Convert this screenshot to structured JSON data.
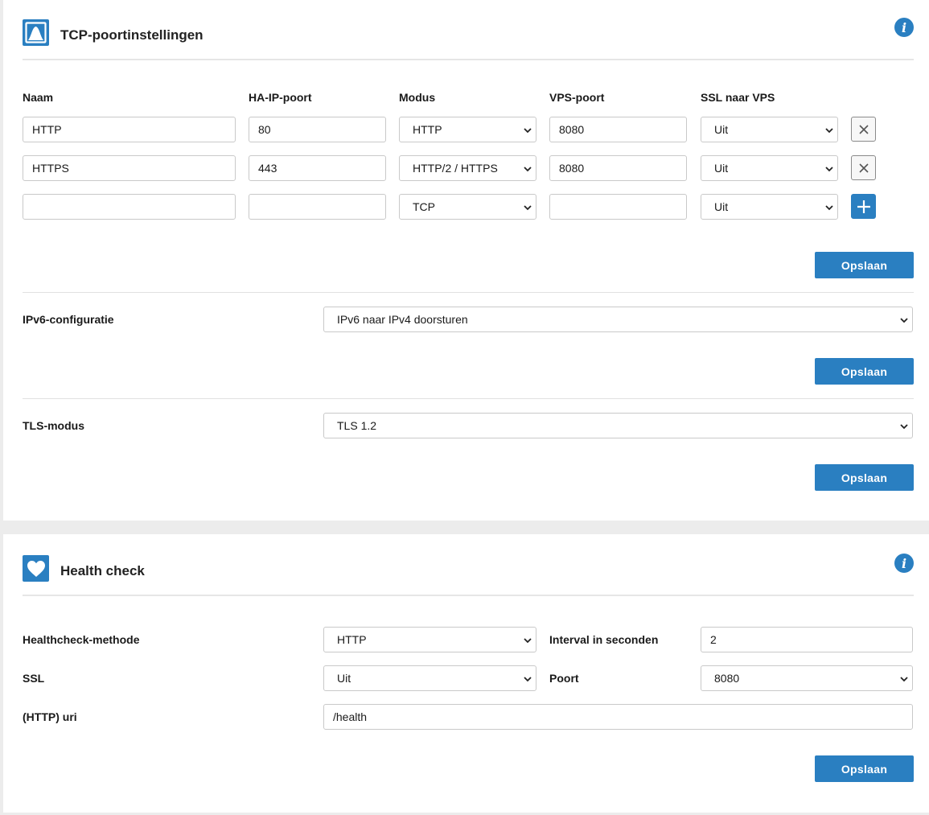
{
  "tcp": {
    "title": "TCP-poortinstellingen",
    "columns": {
      "name": "Naam",
      "ha_ip_port": "HA-IP-poort",
      "mode": "Modus",
      "vps_port": "VPS-poort",
      "ssl": "SSL naar VPS"
    },
    "rows": [
      {
        "name": "HTTP",
        "ha_ip_port": "80",
        "mode": "HTTP",
        "vps_port": "8080",
        "ssl": "Uit"
      },
      {
        "name": "HTTPS",
        "ha_ip_port": "443",
        "mode": "HTTP/2 / HTTPS",
        "vps_port": "8080",
        "ssl": "Uit"
      }
    ],
    "new_row": {
      "name": "",
      "ha_ip_port": "",
      "mode": "TCP",
      "vps_port": "",
      "ssl": "Uit"
    },
    "save_label": "Opslaan"
  },
  "ipv6": {
    "label": "IPv6-configuratie",
    "value": "IPv6 naar IPv4 doorsturen",
    "save_label": "Opslaan"
  },
  "tls": {
    "label": "TLS-modus",
    "value": "TLS 1.2",
    "save_label": "Opslaan"
  },
  "health": {
    "title": "Health check",
    "method_label": "Healthcheck-methode",
    "method_value": "HTTP",
    "interval_label": "Interval in seconden",
    "interval_value": "2",
    "ssl_label": "SSL",
    "ssl_value": "Uit",
    "port_label": "Poort",
    "port_value": "8080",
    "uri_label": "(HTTP) uri",
    "uri_value": "/health",
    "save_label": "Opslaan"
  },
  "icons": {
    "tcp_section": "mountain-icon",
    "health_section": "heart-icon",
    "info": "info-icon",
    "remove": "close-icon",
    "add": "plus-icon"
  },
  "colors": {
    "accent": "#2a7fc1",
    "background": "#ececec",
    "card": "#ffffff"
  }
}
